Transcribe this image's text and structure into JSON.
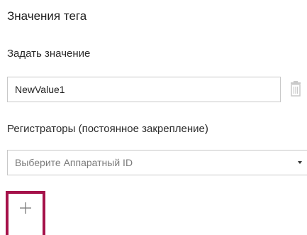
{
  "panel": {
    "title": "Значения тега",
    "set_value_label": "Задать значение",
    "value_input": {
      "value": "NewValue1"
    },
    "registrators_label": "Регистраторы (постоянное закрепление)",
    "hardware_select": {
      "placeholder": "Выберите Аппаратный ID"
    },
    "icons": {
      "delete": "trash-icon",
      "dropdown": "chevron-down-icon",
      "add": "plus-icon"
    },
    "colors": {
      "accent_border": "#a5124a",
      "input_border": "#c8c8c8"
    }
  }
}
